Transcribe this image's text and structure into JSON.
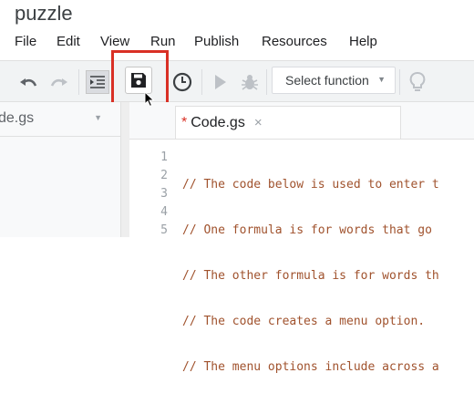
{
  "window": {
    "title": "puzzle"
  },
  "menu": [
    "File",
    "Edit",
    "View",
    "Run",
    "Publish",
    "Resources",
    "Help"
  ],
  "toolbar": {
    "icons": [
      "undo-icon",
      "redo-icon",
      "indent-icon",
      "save-icon",
      "clock-icon",
      "run-icon",
      "debug-icon",
      "lightbulb-icon"
    ],
    "select_function": "Select function"
  },
  "sidebar": {
    "file_dropdown": "de.gs"
  },
  "tabs": [
    {
      "label": "Code.gs",
      "modified_marker": "*",
      "close": "×"
    }
  ],
  "editor": {
    "line_numbers": [
      "1",
      "2",
      "3",
      "4",
      "5"
    ],
    "lines": [
      "// The code below is used to enter t",
      "// One formula is for words that go ",
      "// The other formula is for words th",
      "// The code creates a menu option.",
      "// The menu options include across a"
    ]
  },
  "colors": {
    "highlight": "#d93025",
    "code_comment": "#a0522d",
    "toolbar_bg": "#f1f3f4"
  }
}
